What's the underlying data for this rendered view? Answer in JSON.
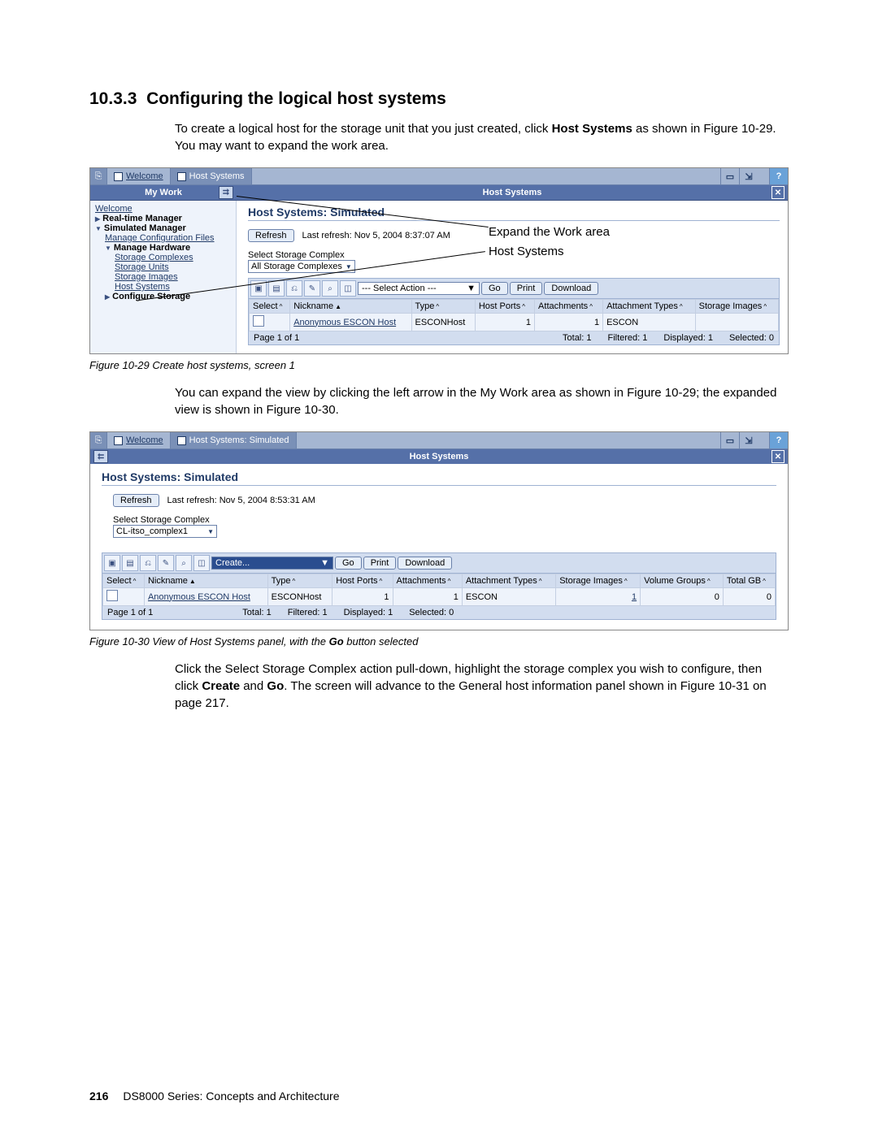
{
  "heading": {
    "number": "10.3.3",
    "title": "Configuring the logical host systems"
  },
  "para1_a": "To create a logical host for the storage unit that you just created, click ",
  "para1_b": "Host Systems",
  "para1_c": " as shown in Figure 10-29. You may want to expand the work area.",
  "fig29": {
    "tabs": {
      "welcome": "Welcome",
      "host_systems": "Host Systems"
    },
    "my_work": "My Work",
    "host_systems_title": "Host Systems",
    "sidebar": {
      "welcome": "Welcome",
      "realtime": "Real-time Manager",
      "sim": "Simulated Manager",
      "manage_config": "Manage Configuration Files",
      "manage_hw": "Manage Hardware",
      "storage_complexes": "Storage Complexes",
      "storage_units": "Storage Units",
      "storage_images": "Storage Images",
      "host_systems": "Host Systems",
      "configure_storage": "Configure Storage"
    },
    "panel_title": "Host Systems: Simulated",
    "refresh": "Refresh",
    "last_refresh": "Last refresh: Nov 5, 2004 8:37:07 AM",
    "select_complex_label": "Select Storage Complex",
    "select_complex_value": "All Storage Complexes",
    "action_placeholder": "--- Select Action ---",
    "go": "Go",
    "print": "Print",
    "download": "Download",
    "columns": [
      "Select",
      "Nickname",
      "Type",
      "Host Ports",
      "Attachments",
      "Attachment Types",
      "Storage Images"
    ],
    "row": {
      "nickname": "Anonymous ESCON Host",
      "type": "ESCONHost",
      "host_ports": "1",
      "attachments": "1",
      "attach_types": "ESCON"
    },
    "footer": {
      "page": "Page 1 of 1",
      "total": "Total: 1",
      "filtered": "Filtered: 1",
      "displayed": "Displayed: 1",
      "selected": "Selected: 0"
    },
    "anno1": "Expand the Work area",
    "anno2": "Host Systems",
    "caption": "Figure 10-29   Create host systems, screen 1"
  },
  "para2": "You can expand the view by clicking the left arrow in the My Work area as shown in Figure 10-29; the expanded view is shown in Figure 10-30.",
  "fig30": {
    "tabs": {
      "welcome": "Welcome",
      "host_systems_sim": "Host Systems: Simulated"
    },
    "title": "Host Systems",
    "panel_title": "Host Systems: Simulated",
    "refresh": "Refresh",
    "last_refresh": "Last refresh: Nov 5, 2004 8:53:31 AM",
    "select_complex_label": "Select Storage Complex",
    "select_complex_value": "CL-itso_complex1",
    "action_value": "Create...",
    "go": "Go",
    "print": "Print",
    "download": "Download",
    "columns": [
      "Select",
      "Nickname",
      "Type",
      "Host Ports",
      "Attachments",
      "Attachment Types",
      "Storage Images",
      "Volume Groups",
      "Total GB"
    ],
    "row": {
      "nickname": "Anonymous ESCON Host",
      "type": "ESCONHost",
      "host_ports": "1",
      "attachments": "1",
      "attach_types": "ESCON",
      "storage_images": "1",
      "volume_groups": "0",
      "total_gb": "0"
    },
    "footer": {
      "page": "Page 1 of 1",
      "total": "Total: 1",
      "filtered": "Filtered: 1",
      "displayed": "Displayed: 1",
      "selected": "Selected: 0"
    },
    "caption_a": "Figure 10-30   View of Host Systems panel, with the ",
    "caption_b": "Go",
    "caption_c": " button selected"
  },
  "para3_a": "Click the Select Storage Complex action pull-down, highlight the storage complex you wish to configure, then click ",
  "para3_b": "Create",
  "para3_c": " and ",
  "para3_d": "Go",
  "para3_e": ". The screen will advance to the General host information panel shown in Figure 10-31 on page 217.",
  "footer": {
    "page": "216",
    "book": "DS8000 Series: Concepts and Architecture"
  }
}
